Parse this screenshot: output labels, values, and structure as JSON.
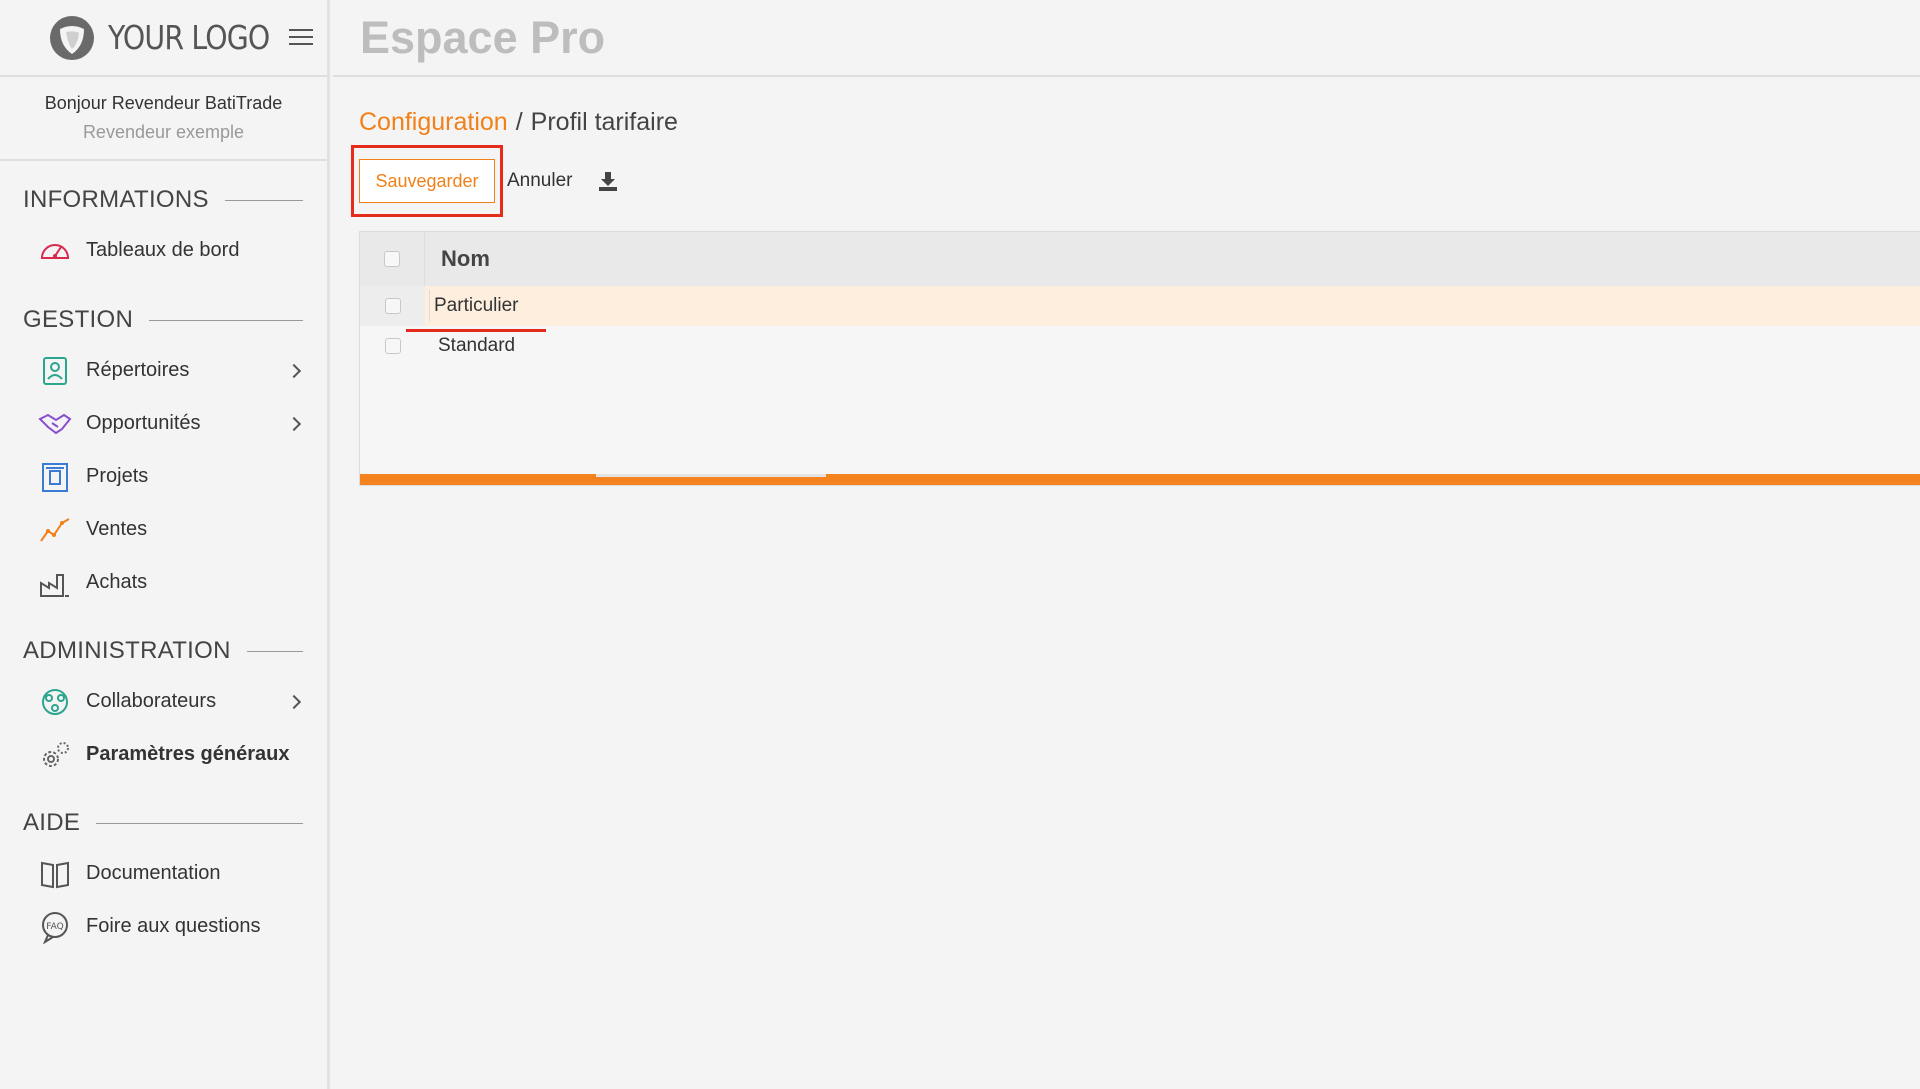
{
  "logo": {
    "text": "YOUR LOGO"
  },
  "user": {
    "greeting": "Bonjour Revendeur BatiTrade",
    "role": "Revendeur exemple"
  },
  "app": {
    "title": "Espace Pro"
  },
  "sidebar": {
    "sections": [
      {
        "title": "INFORMATIONS",
        "items": [
          {
            "label": "Tableaux de bord",
            "icon": "dashboard-gauge-icon",
            "submenu": false
          }
        ]
      },
      {
        "title": "GESTION",
        "items": [
          {
            "label": "Répertoires",
            "icon": "directory-contacts-icon",
            "submenu": true
          },
          {
            "label": "Opportunités",
            "icon": "handshake-icon",
            "submenu": true
          },
          {
            "label": "Projets",
            "icon": "project-building-icon",
            "submenu": false
          },
          {
            "label": "Ventes",
            "icon": "sales-chart-icon",
            "submenu": false
          },
          {
            "label": "Achats",
            "icon": "factory-icon",
            "submenu": false
          }
        ]
      },
      {
        "title": "ADMINISTRATION",
        "items": [
          {
            "label": "Collaborateurs",
            "icon": "team-network-icon",
            "submenu": true
          },
          {
            "label": "Paramètres généraux",
            "icon": "gears-icon",
            "submenu": false
          }
        ]
      },
      {
        "title": "AIDE",
        "items": [
          {
            "label": "Documentation",
            "icon": "book-icon",
            "submenu": false
          },
          {
            "label": "Foire aux questions",
            "icon": "faq-bubble-icon",
            "submenu": false
          }
        ]
      }
    ]
  },
  "breadcrumb": {
    "parent": "Configuration",
    "separator": "/",
    "current": "Profil tarifaire"
  },
  "toolbar": {
    "save_label": "Sauvegarder",
    "cancel_label": "Annuler",
    "download_icon": "download-icon"
  },
  "table": {
    "header": "Nom",
    "editing_value": "Particulier",
    "rows": [
      "Standard"
    ]
  },
  "colors": {
    "accent": "#f28018",
    "highlight": "#e42b1c",
    "editing_row": "#fdeede",
    "footer_bar": "#f4831f"
  }
}
